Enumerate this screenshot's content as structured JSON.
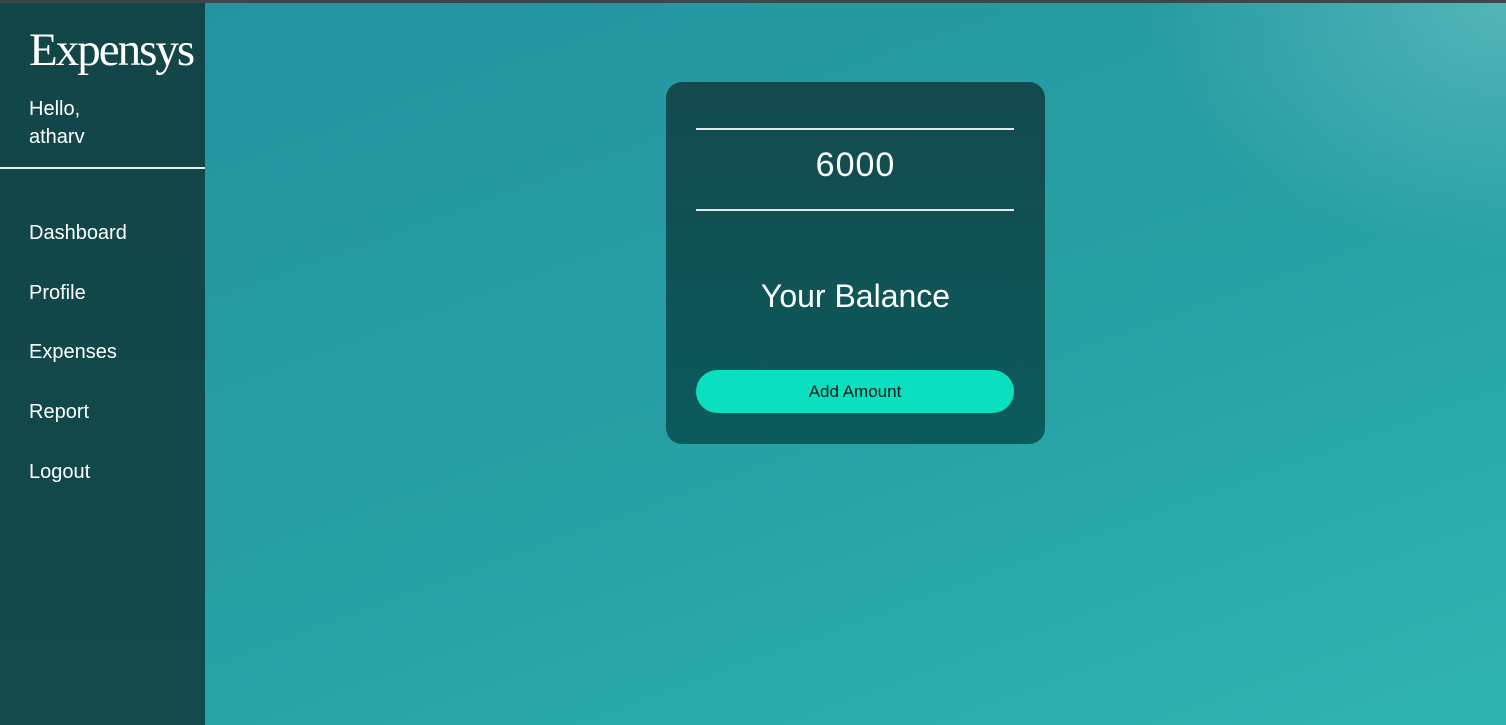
{
  "app": {
    "brand": "Expensys",
    "greeting_line1": "Hello,",
    "greeting_line2": "atharv"
  },
  "sidebar": {
    "items": [
      {
        "label": "Dashboard"
      },
      {
        "label": "Profile"
      },
      {
        "label": "Expenses"
      },
      {
        "label": "Report"
      },
      {
        "label": "Logout"
      }
    ]
  },
  "balance_card": {
    "amount": "6000",
    "label": "Your Balance",
    "button_label": "Add Amount"
  },
  "colors": {
    "sidebar_bg": "#124548",
    "main_bg": "#27a1a5",
    "card_bg": "#0f5253",
    "accent": "#0ae0c0"
  }
}
